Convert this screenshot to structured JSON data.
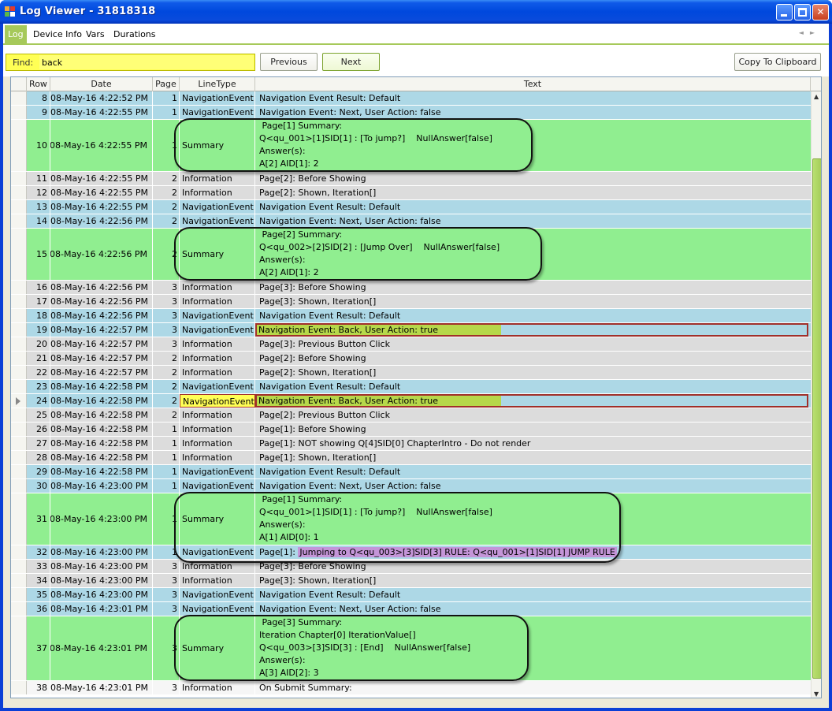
{
  "window": {
    "title": "Log Viewer - 31818318"
  },
  "tabs": [
    {
      "label": "Log",
      "active": true
    },
    {
      "label": "Device Info"
    },
    {
      "label": "Vars"
    },
    {
      "label": "Durations"
    }
  ],
  "find": {
    "label": "Find:",
    "value": "back"
  },
  "buttons": {
    "previous": "Previous",
    "next": "Next",
    "copy": "Copy To Clipboard"
  },
  "columns": [
    "Row",
    "Date",
    "Page",
    "LineType",
    "Text"
  ],
  "colors": {
    "navigation": "#add8e6",
    "information": "#dcdcdc",
    "summary": "#90ee90",
    "find_highlight": "#ffff55",
    "match_text": "#b6d84a",
    "jump_text": "#c495d8"
  },
  "rows": [
    {
      "row": "8",
      "date": "08-May-16 4:22:52 PM",
      "page": "1",
      "type": "NavigationEvent",
      "text": [
        "Navigation Event Result: Default"
      ]
    },
    {
      "row": "9",
      "date": "08-May-16 4:22:55 PM",
      "page": "1",
      "type": "NavigationEvent",
      "text": [
        "Navigation Event: Next, User Action: false"
      ]
    },
    {
      "row": "10",
      "date": "08-May-16 4:22:55 PM",
      "page": "1",
      "type": "Summary",
      "text": [
        " Page[1] Summary:",
        "Q<qu_001>[1]SID[1] : [To jump?]    NullAnswer[false]",
        "Answer(s):",
        "A[2] AID[1]: 2"
      ]
    },
    {
      "row": "11",
      "date": "08-May-16 4:22:55 PM",
      "page": "2",
      "type": "Information",
      "text": [
        "Page[2]: Before Showing"
      ]
    },
    {
      "row": "12",
      "date": "08-May-16 4:22:55 PM",
      "page": "2",
      "type": "Information",
      "text": [
        "Page[2]: Shown, Iteration[]"
      ]
    },
    {
      "row": "13",
      "date": "08-May-16 4:22:55 PM",
      "page": "2",
      "type": "NavigationEvent",
      "text": [
        "Navigation Event Result: Default"
      ]
    },
    {
      "row": "14",
      "date": "08-May-16 4:22:56 PM",
      "page": "2",
      "type": "NavigationEvent",
      "text": [
        "Navigation Event: Next, User Action: false"
      ]
    },
    {
      "row": "15",
      "date": "08-May-16 4:22:56 PM",
      "page": "2",
      "type": "Summary",
      "text": [
        " Page[2] Summary:",
        "Q<qu_002>[2]SID[2] : [Jump Over]    NullAnswer[false]",
        "Answer(s):",
        "A[2] AID[1]: 2"
      ]
    },
    {
      "row": "16",
      "date": "08-May-16 4:22:56 PM",
      "page": "3",
      "type": "Information",
      "text": [
        "Page[3]: Before Showing"
      ]
    },
    {
      "row": "17",
      "date": "08-May-16 4:22:56 PM",
      "page": "3",
      "type": "Information",
      "text": [
        "Page[3]: Shown, Iteration[]"
      ]
    },
    {
      "row": "18",
      "date": "08-May-16 4:22:56 PM",
      "page": "3",
      "type": "NavigationEvent",
      "text": [
        "Navigation Event Result: Default"
      ]
    },
    {
      "row": "19",
      "date": "08-May-16 4:22:57 PM",
      "page": "3",
      "type": "NavigationEvent",
      "text": [
        "Navigation Event: Back, User Action: true"
      ],
      "match": true
    },
    {
      "row": "20",
      "date": "08-May-16 4:22:57 PM",
      "page": "3",
      "type": "Information",
      "text": [
        "Page[3]: Previous Button Click"
      ]
    },
    {
      "row": "21",
      "date": "08-May-16 4:22:57 PM",
      "page": "2",
      "type": "Information",
      "text": [
        "Page[2]: Before Showing"
      ]
    },
    {
      "row": "22",
      "date": "08-May-16 4:22:57 PM",
      "page": "2",
      "type": "Information",
      "text": [
        "Page[2]: Shown, Iteration[]"
      ]
    },
    {
      "row": "23",
      "date": "08-May-16 4:22:58 PM",
      "page": "2",
      "type": "NavigationEvent",
      "text": [
        "Navigation Event Result: Default"
      ]
    },
    {
      "row": "24",
      "date": "08-May-16 4:22:58 PM",
      "page": "2",
      "type": "NavigationEvent",
      "text": [
        "Navigation Event: Back, User Action: true"
      ],
      "match": true,
      "current": true
    },
    {
      "row": "25",
      "date": "08-May-16 4:22:58 PM",
      "page": "2",
      "type": "Information",
      "text": [
        "Page[2]: Previous Button Click"
      ]
    },
    {
      "row": "26",
      "date": "08-May-16 4:22:58 PM",
      "page": "1",
      "type": "Information",
      "text": [
        "Page[1]: Before Showing"
      ]
    },
    {
      "row": "27",
      "date": "08-May-16 4:22:58 PM",
      "page": "1",
      "type": "Information",
      "text": [
        "Page[1]: NOT showing Q[4]SID[0] ChapterIntro - Do not render"
      ]
    },
    {
      "row": "28",
      "date": "08-May-16 4:22:58 PM",
      "page": "1",
      "type": "Information",
      "text": [
        "Page[1]: Shown, Iteration[]"
      ]
    },
    {
      "row": "29",
      "date": "08-May-16 4:22:58 PM",
      "page": "1",
      "type": "NavigationEvent",
      "text": [
        "Navigation Event Result: Default"
      ]
    },
    {
      "row": "30",
      "date": "08-May-16 4:23:00 PM",
      "page": "1",
      "type": "NavigationEvent",
      "text": [
        "Navigation Event: Next, User Action: false"
      ]
    },
    {
      "row": "31",
      "date": "08-May-16 4:23:00 PM",
      "page": "1",
      "type": "Summary",
      "text": [
        " Page[1] Summary:",
        "Q<qu_001>[1]SID[1] : [To jump?]    NullAnswer[false]",
        "Answer(s):",
        "A[1] AID[0]: 1"
      ]
    },
    {
      "row": "32",
      "date": "08-May-16 4:23:00 PM",
      "page": "1",
      "type": "NavigationEvent",
      "text": [
        "Page[1]: "
      ],
      "jump": "Jumping to Q<qu_003>[3]SID[3] RULE: Q<qu_001>[1]SID[1] JUMP RULE"
    },
    {
      "row": "33",
      "date": "08-May-16 4:23:00 PM",
      "page": "3",
      "type": "Information",
      "text": [
        "Page[3]: Before Showing"
      ]
    },
    {
      "row": "34",
      "date": "08-May-16 4:23:00 PM",
      "page": "3",
      "type": "Information",
      "text": [
        "Page[3]: Shown, Iteration[]"
      ]
    },
    {
      "row": "35",
      "date": "08-May-16 4:23:00 PM",
      "page": "3",
      "type": "NavigationEvent",
      "text": [
        "Navigation Event Result: Default"
      ]
    },
    {
      "row": "36",
      "date": "08-May-16 4:23:01 PM",
      "page": "3",
      "type": "NavigationEvent",
      "text": [
        "Navigation Event: Next, User Action: false"
      ]
    },
    {
      "row": "37",
      "date": "08-May-16 4:23:01 PM",
      "page": "3",
      "type": "Summary",
      "text": [
        " Page[3] Summary:",
        "Iteration Chapter[0] IterationValue[]",
        "Q<qu_003>[3]SID[3] : [End]    NullAnswer[false]",
        "Answer(s):",
        "A[3] AID[2]: 3"
      ]
    },
    {
      "row": "38",
      "date": "08-May-16 4:23:01 PM",
      "page": "3",
      "type": "Information",
      "text": [
        " On Submit Summary:"
      ],
      "onsubmit": true
    }
  ]
}
